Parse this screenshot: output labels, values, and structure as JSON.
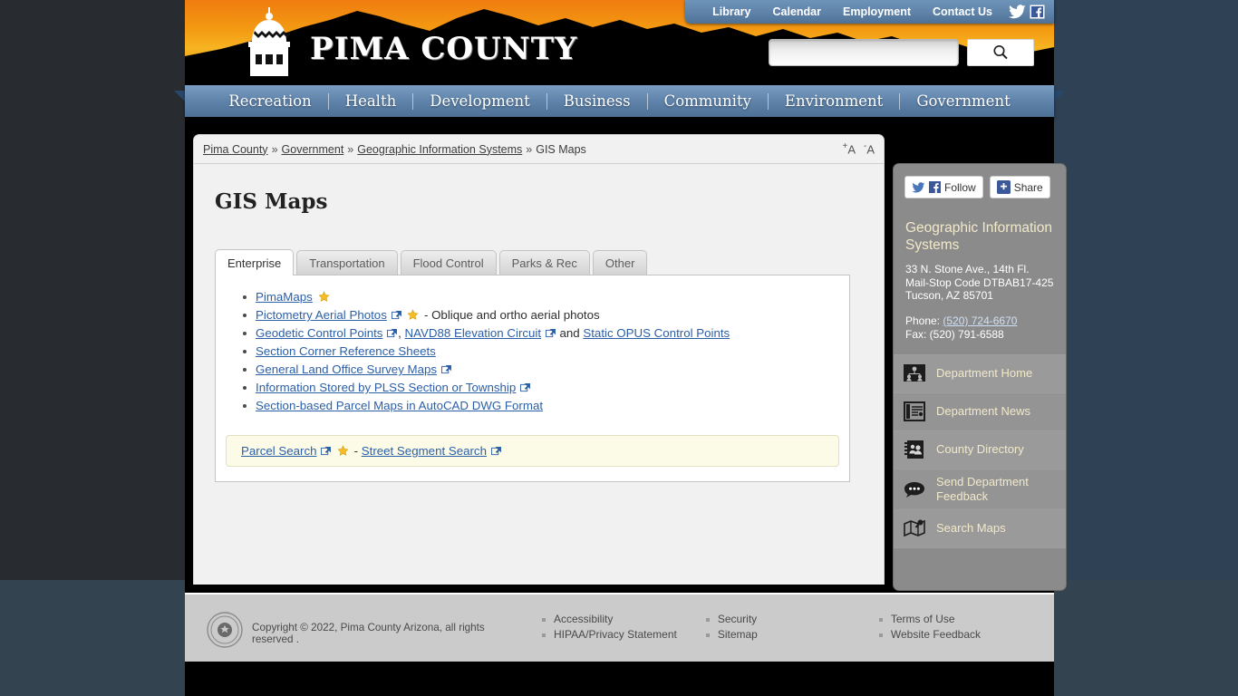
{
  "header": {
    "county_title": "PIMA COUNTY",
    "utility_links": [
      {
        "label": "Library"
      },
      {
        "label": "Calendar"
      },
      {
        "label": "Employment"
      },
      {
        "label": "Contact Us"
      }
    ],
    "twitter_icon": "twitter-icon",
    "facebook_icon": "facebook-icon",
    "search": {
      "value": "",
      "placeholder": "",
      "button_icon": "search-icon"
    }
  },
  "nav": {
    "items": [
      {
        "label": "Recreation"
      },
      {
        "label": "Health"
      },
      {
        "label": "Development"
      },
      {
        "label": "Business"
      },
      {
        "label": "Community"
      },
      {
        "label": "Environment"
      },
      {
        "label": "Government"
      }
    ]
  },
  "breadcrumb": {
    "items": [
      {
        "label": "Pima County",
        "link": true
      },
      {
        "label": "Government",
        "link": true
      },
      {
        "label": "Geographic Information Systems",
        "link": true
      },
      {
        "label": "GIS Maps",
        "link": false
      }
    ],
    "separator": "»",
    "increase_font": "A",
    "decrease_font": "A",
    "increase_sign": "+",
    "decrease_sign": "-"
  },
  "main": {
    "page_title": "GIS Maps",
    "tabs": [
      {
        "label": "Enterprise",
        "active": true
      },
      {
        "label": "Transportation",
        "active": false
      },
      {
        "label": "Flood Control",
        "active": false
      },
      {
        "label": "Parks & Rec",
        "active": false
      },
      {
        "label": "Other",
        "active": false
      }
    ],
    "links": [
      {
        "text": "PimaMaps",
        "external": false,
        "star": true,
        "suffix": ""
      },
      {
        "text": "Pictometry Aerial Photos",
        "external": true,
        "star": true,
        "suffix": " - Oblique and ortho aerial photos"
      },
      {
        "text": "Geodetic Control Points",
        "external": true,
        "star": false,
        "suffix": ",",
        "extra": [
          {
            "text": "NAVD88 Elevation Circuit",
            "external": true,
            "mid": " and "
          },
          {
            "text": "Static OPUS Control Points",
            "external": false,
            "mid": ""
          }
        ]
      },
      {
        "text": "Section Corner Reference Sheets",
        "external": false,
        "star": false,
        "suffix": ""
      },
      {
        "text": "General Land Office Survey Maps",
        "external": true,
        "star": false,
        "suffix": ""
      },
      {
        "text": "Information Stored by PLSS Section or Township",
        "external": true,
        "star": false,
        "suffix": ""
      },
      {
        "text": "Section-based Parcel Maps in AutoCAD DWG Format",
        "external": false,
        "star": false,
        "suffix": ""
      }
    ],
    "highlight_box": {
      "link1": "Parcel Search",
      "separator": "-",
      "link2": "Street Segment Search"
    }
  },
  "sidebar": {
    "follow_label": "Follow",
    "share_label": "Share",
    "share_plus": "+",
    "department_name": "Geographic Information Systems",
    "address_line1": "33 N. Stone Ave., 14th Fl.",
    "address_line2": "Mail-Stop Code DTBAB17-425",
    "address_line3": "Tucson, AZ 85701",
    "phone_label": "Phone:",
    "phone_value": "(520) 724-6670",
    "fax_line": "Fax: (520) 791-6588",
    "items": [
      {
        "label": "Department Home",
        "icon": "department-home-icon"
      },
      {
        "label": "Department News",
        "icon": "department-news-icon"
      },
      {
        "label": "County Directory",
        "icon": "county-directory-icon"
      },
      {
        "label": "Send Department Feedback",
        "icon": "feedback-speech-bubble-icon"
      },
      {
        "label": "Search Maps",
        "icon": "search-maps-icon"
      }
    ]
  },
  "footer": {
    "seal_icon": "pima-county-seal-icon",
    "copyright": "Copyright © 2022, Pima County Arizona, all rights reserved .",
    "columns": [
      {
        "links": [
          {
            "label": "Accessibility"
          },
          {
            "label": "HIPAA/Privacy Statement"
          }
        ]
      },
      {
        "links": [
          {
            "label": "Security"
          },
          {
            "label": "Sitemap"
          }
        ]
      },
      {
        "links": [
          {
            "label": "Terms of Use"
          },
          {
            "label": "Website Feedback"
          }
        ]
      }
    ]
  },
  "colors": {
    "brand_orange": "#f39a12",
    "nav_blue": "#5f83aa",
    "link_blue": "#2b5fa8",
    "sidebar_gray": "#8b8b8b",
    "sidebar_heading": "#f2e9c9",
    "highlight_bg": "#fcfbe8",
    "page_backdrop": "#2f4155"
  }
}
